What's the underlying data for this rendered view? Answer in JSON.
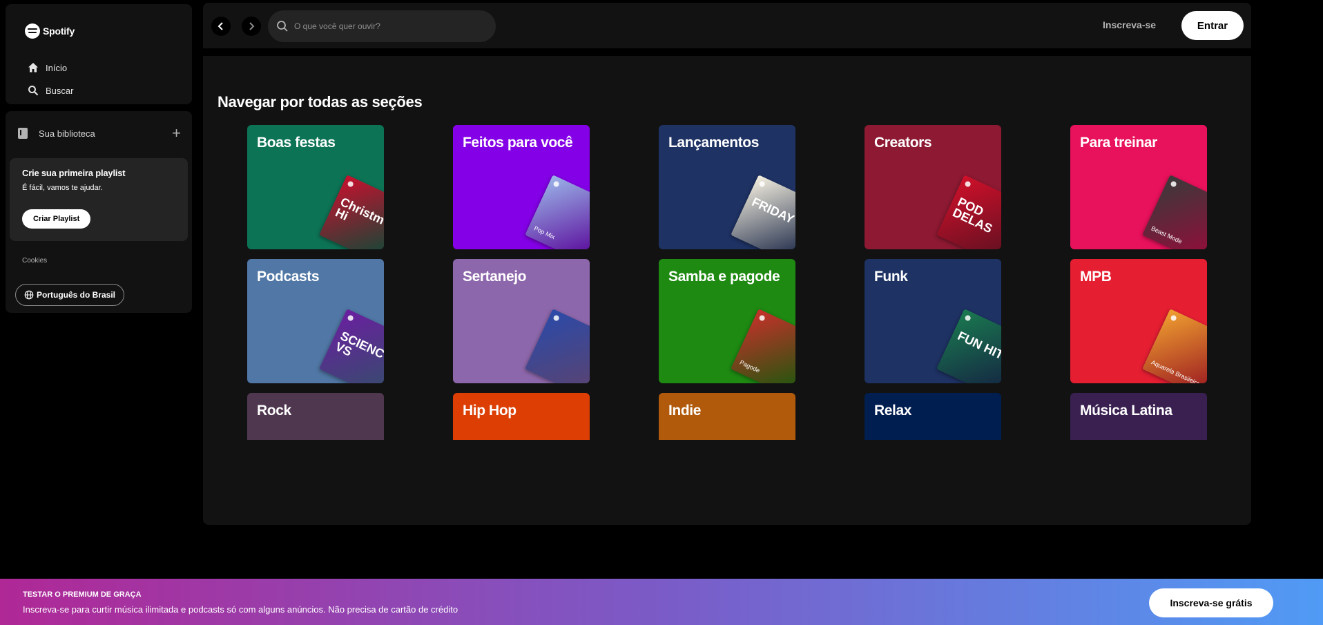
{
  "app": {
    "name": "Spotify"
  },
  "nav": {
    "home": "Início",
    "search": "Buscar"
  },
  "library": {
    "title": "Sua biblioteca",
    "card_title": "Crie sua primeira playlist",
    "card_text": "É fácil, vamos te ajudar.",
    "create_button": "Criar Playlist",
    "cookies": "Cookies",
    "language": "Português do Brasil"
  },
  "topbar": {
    "search_placeholder": "O que você quer ouvir?",
    "signup": "Inscreva-se",
    "login": "Entrar"
  },
  "main": {
    "heading": "Navegar por todas as seções",
    "tiles": [
      {
        "label": "Boas festas",
        "color": "#0d7355",
        "cover_color": "#c8102e",
        "cover_text": "Christm Hi",
        "cover_sub": ""
      },
      {
        "label": "Feitos para você",
        "color": "#8400e7",
        "cover_color": "#9bb5e8",
        "cover_text": "",
        "cover_sub": "Pop Mix"
      },
      {
        "label": "Lançamentos",
        "color": "#1e3264",
        "cover_color": "#f5f0e0",
        "cover_text": "FRIDAY",
        "cover_sub": ""
      },
      {
        "label": "Creators",
        "color": "#8d1932",
        "cover_color": "#d0102a",
        "cover_text": "POD DELAS",
        "cover_sub": ""
      },
      {
        "label": "Para treinar",
        "color": "#e8115b",
        "cover_color": "#3a3a3a",
        "cover_text": "",
        "cover_sub": "Beast Mode"
      },
      {
        "label": "Podcasts",
        "color": "#5077a5",
        "cover_color": "#6a1fa0",
        "cover_text": "SCIENC VS",
        "cover_sub": ""
      },
      {
        "label": "Sertanejo",
        "color": "#8d67ab",
        "cover_color": "#2b4aa8",
        "cover_text": "",
        "cover_sub": ""
      },
      {
        "label": "Samba e pagode",
        "color": "#1e8a12",
        "cover_color": "#c8302a",
        "cover_text": "",
        "cover_sub": "Pagode"
      },
      {
        "label": "Funk",
        "color": "#1e3264",
        "cover_color": "#1a7a50",
        "cover_text": "FUN HITS",
        "cover_sub": ""
      },
      {
        "label": "MPB",
        "color": "#e61e32",
        "cover_color": "#f0a030",
        "cover_text": "",
        "cover_sub": "Aquarela Brasileira"
      },
      {
        "label": "Rock",
        "color": "#503750",
        "cover_color": "#503750",
        "cover_text": "",
        "cover_sub": ""
      },
      {
        "label": "Hip Hop",
        "color": "#dc3e03",
        "cover_color": "#dc3e03",
        "cover_text": "",
        "cover_sub": ""
      },
      {
        "label": "Indie",
        "color": "#b15a0b",
        "cover_color": "#b15a0b",
        "cover_text": "",
        "cover_sub": ""
      },
      {
        "label": "Relax",
        "color": "#011e50",
        "cover_color": "#011e50",
        "cover_text": "",
        "cover_sub": ""
      },
      {
        "label": "Música Latina",
        "color": "#3a2051",
        "cover_color": "#3a2051",
        "cover_text": "",
        "cover_sub": ""
      }
    ]
  },
  "banner": {
    "title": "TESTAR O PREMIUM DE GRAÇA",
    "text": "Inscreva-se para curtir música ilimitada e podcasts só com alguns anúncios. Não precisa de cartão de crédito",
    "button": "Inscreva-se grátis"
  }
}
